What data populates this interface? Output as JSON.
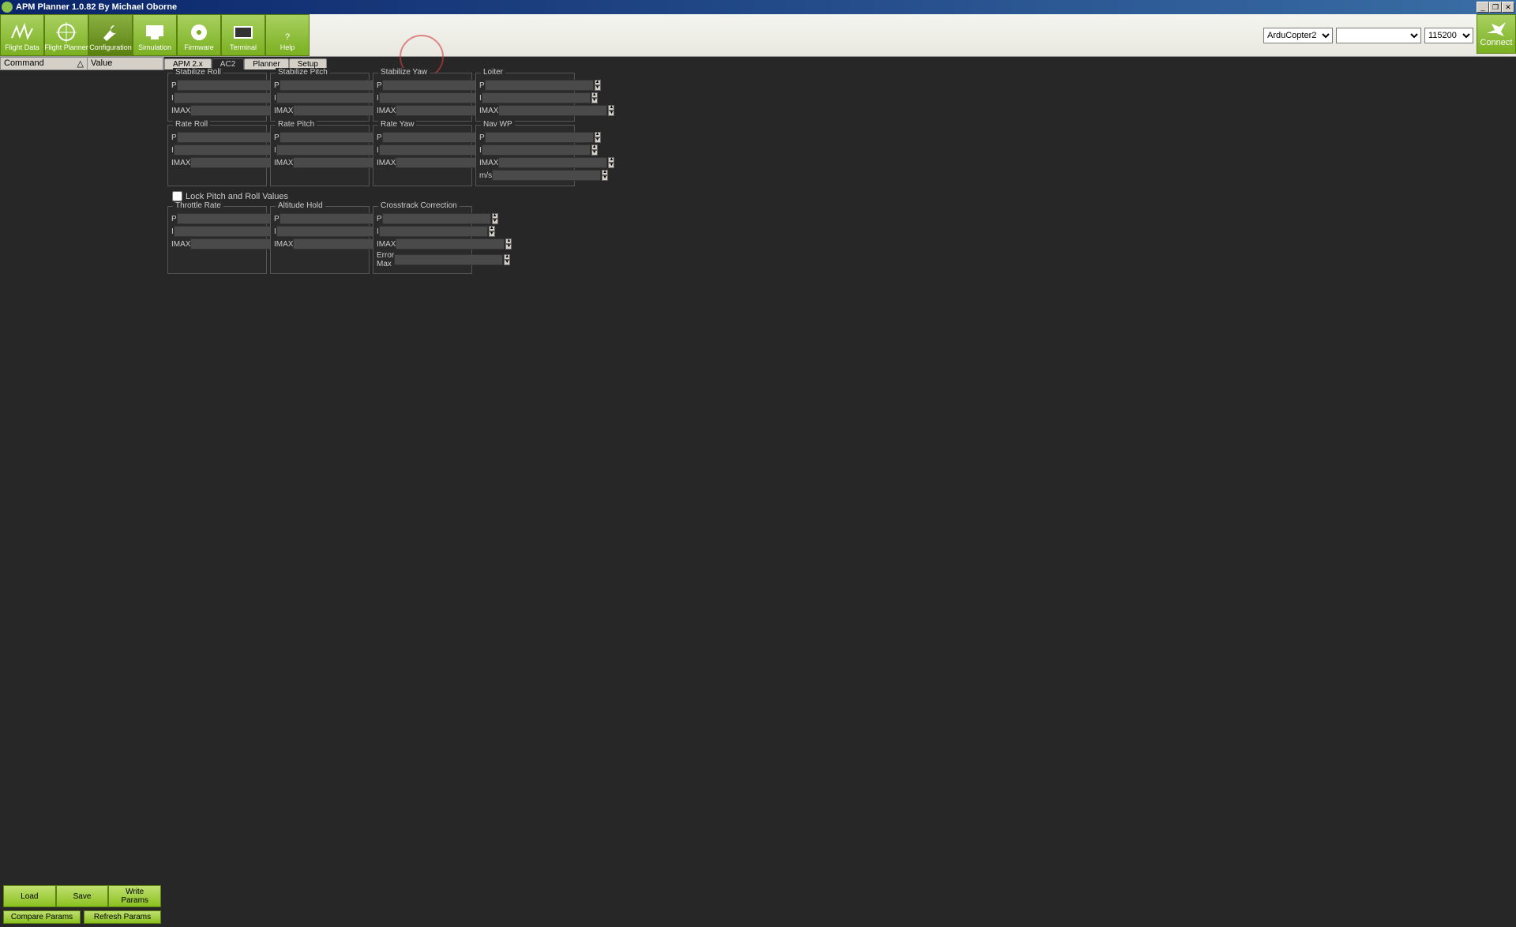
{
  "title": "APM Planner 1.0.82  By Michael Oborne",
  "toolbar": {
    "items": [
      {
        "label": "Flight Data",
        "icon": "wave"
      },
      {
        "label": "Flight Planner",
        "icon": "target"
      },
      {
        "label": "Configuration",
        "icon": "wrench",
        "active": true
      },
      {
        "label": "Simulation",
        "icon": "sim"
      },
      {
        "label": "Firmware",
        "icon": "disc"
      },
      {
        "label": "Terminal",
        "icon": "terminal"
      },
      {
        "label": "Help",
        "icon": "help"
      }
    ]
  },
  "header_selects": {
    "vehicle": "ArduCopter2",
    "port": "",
    "baud": "115200"
  },
  "connect_label": "Connect",
  "left": {
    "command_col": "Command",
    "value_col": "Value",
    "sort_indicator": "△",
    "buttons": {
      "load": "Load",
      "save": "Save",
      "write": "Write Params",
      "compare": "Compare Params",
      "refresh": "Refresh Params"
    }
  },
  "tabs": [
    "APM 2.x",
    "AC2",
    "Planner",
    "Setup"
  ],
  "active_tab": "AC2",
  "groups_row1": [
    {
      "title": "Stabilize Roll",
      "fields": [
        "P",
        "I",
        "IMAX"
      ]
    },
    {
      "title": "Stabilize Pitch",
      "fields": [
        "P",
        "I",
        "IMAX"
      ]
    },
    {
      "title": "Stabilize Yaw",
      "fields": [
        "P",
        "I",
        "IMAX"
      ]
    },
    {
      "title": "Loiter",
      "fields": [
        "P",
        "I",
        "IMAX"
      ]
    }
  ],
  "groups_row2": [
    {
      "title": "Rate Roll",
      "fields": [
        "P",
        "I",
        "IMAX"
      ]
    },
    {
      "title": "Rate Pitch",
      "fields": [
        "P",
        "I",
        "IMAX"
      ]
    },
    {
      "title": "Rate Yaw",
      "fields": [
        "P",
        "I",
        "IMAX"
      ]
    },
    {
      "title": "Nav WP",
      "fields": [
        "P",
        "I",
        "IMAX",
        "m/s"
      ]
    }
  ],
  "lock_label": "Lock Pitch and Roll Values",
  "groups_row3": [
    {
      "title": "Throttle Rate",
      "fields": [
        "P",
        "I",
        "IMAX"
      ]
    },
    {
      "title": "Altitude Hold",
      "fields": [
        "P",
        "I",
        "IMAX"
      ]
    },
    {
      "title": "Crosstrack Correction",
      "fields": [
        "P",
        "I",
        "IMAX",
        "Error Max"
      ]
    }
  ]
}
